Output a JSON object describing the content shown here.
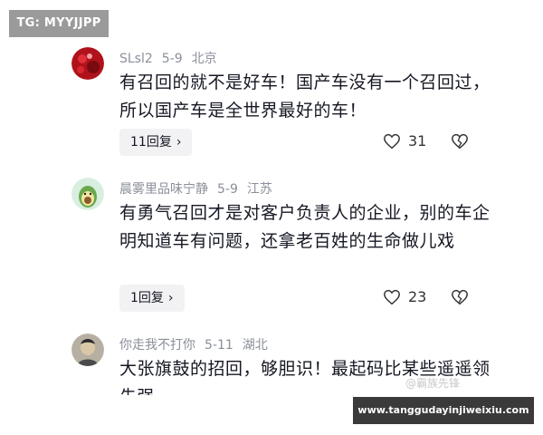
{
  "overlay": {
    "tg_label": "TG: MYYJJPP",
    "site_watermark": "www.tanggudayinjiweixiu.com",
    "faint_watermark": "@霸族先锋"
  },
  "comments": [
    {
      "username": "SLsl2",
      "date": "5-9",
      "location": "北京",
      "text": "有召回的就不是好车！国产车没有一个召回过，所以国产车是全世界最好的车！",
      "replies": "11回复",
      "likes": "31"
    },
    {
      "username": "晨雾里品味宁静",
      "date": "5-9",
      "location": "江苏",
      "text": "有勇气召回才是对客户负责人的企业，别的车企明知道车有问题，还拿老百姓的生命做儿戏",
      "replies": "1回复",
      "likes": "23"
    },
    {
      "username": "你走我不打你",
      "date": "5-11",
      "location": "湖北",
      "text": "大张旗鼓的招回，够胆识！最起码比某些遥遥领先强"
    }
  ],
  "icons": {
    "reply_chevron": "chevron-right-icon",
    "like": "heart-outline-icon",
    "dislike": "broken-heart-icon"
  }
}
